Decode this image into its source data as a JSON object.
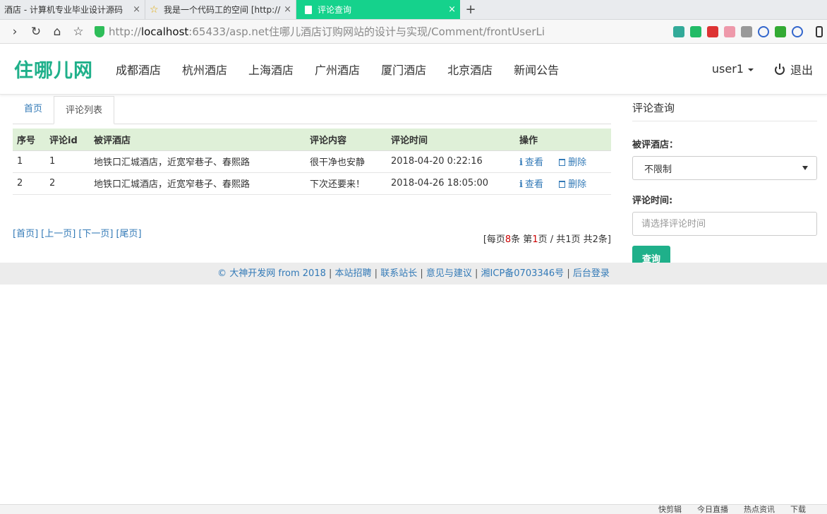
{
  "browser": {
    "tabs": [
      {
        "title": "酒店 - 计算机专业毕业设计源码"
      },
      {
        "title": "我是一个代码工的空间 [http://"
      },
      {
        "title": "评论查询"
      }
    ],
    "url_prefix": "http://",
    "url_host": "localhost",
    "url_rest": ":65433/asp.net住哪儿酒店订购网站的设计与实现/Comment/frontUserLi"
  },
  "site": {
    "logo": "住哪儿网",
    "menu": [
      "成都酒店",
      "杭州酒店",
      "上海酒店",
      "广州酒店",
      "厦门酒店",
      "北京酒店",
      "新闻公告"
    ],
    "user": "user1",
    "logout": "退出"
  },
  "tabs": [
    "首页",
    "评论列表"
  ],
  "table": {
    "headers": [
      "序号",
      "评论id",
      "被评酒店",
      "评论内容",
      "评论时间",
      "操作"
    ],
    "rows": [
      {
        "no": "1",
        "id": "1",
        "hotel": "地铁口汇城酒店，近宽窄巷子、春熙路",
        "content": "很干净也安静",
        "time": "2018-04-20 0:22:16"
      },
      {
        "no": "2",
        "id": "2",
        "hotel": "地铁口汇城酒店，近宽窄巷子、春熙路",
        "content": "下次还要来！",
        "time": "2018-04-26 18:05:00"
      }
    ],
    "view_label": "查看",
    "delete_label": "删除"
  },
  "pager": {
    "first": "[首页]",
    "prev": "[上一页]",
    "next": "[下一页]",
    "last": "[尾页]",
    "info_a": "[每页",
    "per_page": "8",
    "info_b": "条 第",
    "page": "1",
    "info_c": "页 / 共1页 共2条]"
  },
  "sidebar": {
    "title": "评论查询",
    "hotel_label": "被评酒店：",
    "hotel_value": "不限制",
    "time_label": "评论时间:",
    "time_placeholder": "请选择评论时间",
    "query_button": "查询"
  },
  "footer": {
    "copyright": "© 大神开发网 from 2018",
    "links": [
      "本站招聘",
      "联系站长",
      "意见与建议",
      "湘ICP备0703346号",
      "后台登录"
    ]
  },
  "statusbar": [
    "快剪辑",
    "今日直播",
    "热点资讯",
    "下载"
  ],
  "colors": {
    "brand": "#1fb08a",
    "link": "#337ab7",
    "table_header": "#dff0d8",
    "active_tab": "#15d28c"
  }
}
